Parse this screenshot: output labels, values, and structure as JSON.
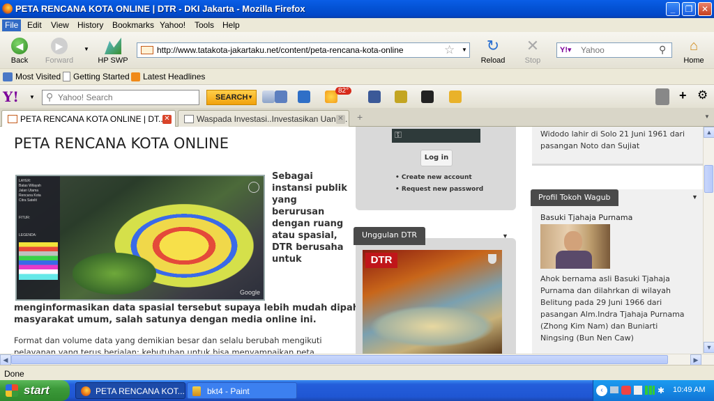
{
  "window": {
    "title": "PETA RENCANA KOTA ONLINE | DTR - DKI Jakarta - Mozilla Firefox"
  },
  "menu": [
    "File",
    "Edit",
    "View",
    "History",
    "Bookmarks",
    "Yahoo!",
    "Tools",
    "Help"
  ],
  "nav": {
    "back": "Back",
    "forward": "Forward",
    "hpswp": "HP SWP",
    "reload": "Reload",
    "stop": "Stop",
    "home": "Home",
    "url": "http://www.tatakota-jakartaku.net/content/peta-rencana-kota-online",
    "search_placeholder": "Yahoo"
  },
  "bookmarks": [
    "Most Visited",
    "Getting Started",
    "Latest Headlines"
  ],
  "ytoolbar": {
    "search_placeholder": "Yahoo! Search",
    "search_btn": "SEARCH",
    "weather": "82°"
  },
  "tabs": [
    {
      "label": "PETA RENCANA KOTA ONLINE | DT...",
      "active": true
    },
    {
      "label": "Waspada Investasi..Investasikan Uang...",
      "active": false
    }
  ],
  "page": {
    "title": "PETA RENCANA KOTA ONLINE",
    "intro_side": [
      "Sebagai",
      "instansi publik",
      "yang",
      "berurusan",
      "dengan ruang",
      "atau spasial,",
      "DTR berusaha",
      "untuk"
    ],
    "intro_full": [
      "menginformasikan data spasial tersebut supaya lebih mudah dipahami",
      "masyarakat umum, salah satunya dengan media online ini."
    ],
    "body": [
      "Format dan volume data yang demikian besar dan selalu berubah mengikuti",
      "pelayanan yang terus berjalan; kebutuhan untuk bisa menyampaikan peta"
    ],
    "map_legend": [
      "LAYER:",
      "Batas Wilayah",
      "Jalan Utama",
      "Rencana Kota",
      "Citra Satelit",
      "FITUR:",
      "LEGENDA:"
    ]
  },
  "login": {
    "button": "Log in",
    "links": [
      "Create new account",
      "Request new password"
    ]
  },
  "unggulan": {
    "title": "Unggulan DTR",
    "logo": "DTR"
  },
  "right": {
    "top_text": [
      "Widodo lahir di Solo 21 Juni 1961 dari",
      "pasangan Noto dan Sujiat"
    ],
    "wagub_title": "Profil Tokoh Wagub",
    "wagub_name": "Basuki Tjahaja Purnama",
    "wagub_text": [
      "Ahok bernama asli Basuki Tjahaja",
      "Purnama dan dilahrkan di wilayah",
      "Belitung pada 29 Juni 1966 dari",
      "pasangan Alm.Indra Tjahaja Purnama",
      "(Zhong Kim Nam) dan Buniarti",
      "Ningsing (Bun Nen Caw)"
    ]
  },
  "status": "Done",
  "taskbar": {
    "start": "start",
    "items": [
      "PETA RENCANA KOT...",
      "bkt4 - Paint"
    ],
    "time": "10:49 AM"
  }
}
